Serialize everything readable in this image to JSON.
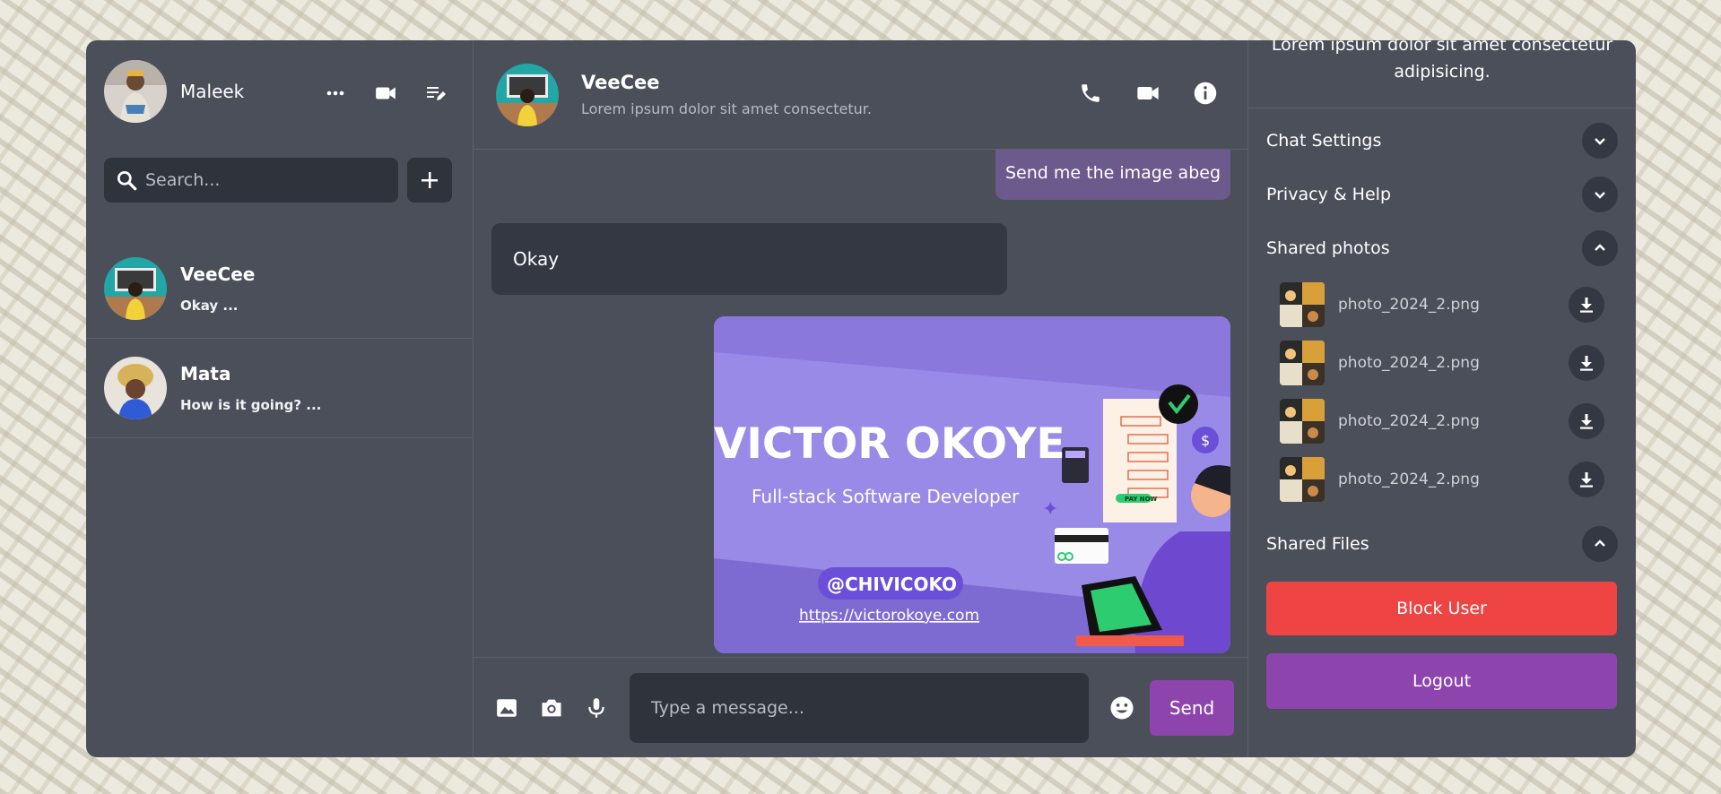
{
  "user": {
    "name": "Maleek"
  },
  "search": {
    "placeholder": "Search..."
  },
  "chats": [
    {
      "name": "VeeCee",
      "last": "Okay ..."
    },
    {
      "name": "Mata",
      "last": "How is it going? ..."
    }
  ],
  "active_chat": {
    "name": "VeeCee",
    "description": "Lorem ipsum dolor sit amet consectetur."
  },
  "messages": {
    "own_text": "Send me the image abeg",
    "other_text": "Okay",
    "image": {
      "name": "VICTOR OKOYE",
      "role": "Full-stack Software Developer",
      "handle": "@CHIVICOKO",
      "url": "https://victorokoye.com",
      "tag": "PAY NOW"
    }
  },
  "composer": {
    "placeholder": "Type a message...",
    "send_label": "Send"
  },
  "details": {
    "bio": "Lorem ipsum dolor sit amet consectetur adipisicing.",
    "sections": {
      "chat_settings": "Chat Settings",
      "privacy": "Privacy & Help",
      "shared_photos": "Shared photos",
      "shared_files": "Shared Files"
    },
    "photos": [
      {
        "name": "photo_2024_2.png"
      },
      {
        "name": "photo_2024_2.png"
      },
      {
        "name": "photo_2024_2.png"
      },
      {
        "name": "photo_2024_2.png"
      }
    ],
    "block_label": "Block User",
    "logout_label": "Logout"
  },
  "colors": {
    "panel": "#4b4f59",
    "input_bg": "#2f333b",
    "accent": "#8e44ad",
    "danger": "#ef4444",
    "own_bubble": "#6c5a8c"
  }
}
